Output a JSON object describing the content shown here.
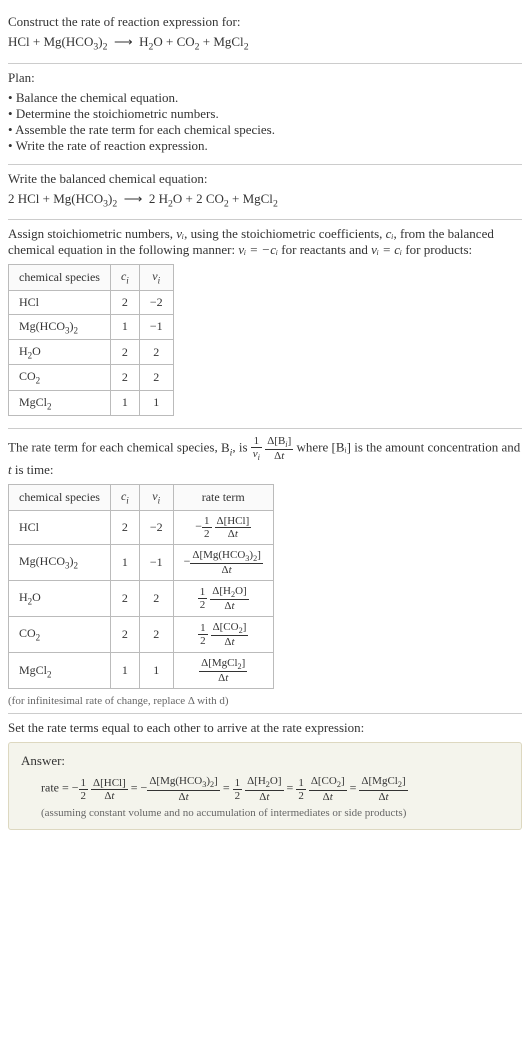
{
  "header": {
    "prompt": "Construct the rate of reaction expression for:",
    "equation_lhs": "HCl + Mg(HCO3)",
    "equation_arrow": "⟶",
    "equation_rhs": "H₂O + CO₂ + MgCl₂"
  },
  "plan": {
    "label": "Plan:",
    "items": [
      "Balance the chemical equation.",
      "Determine the stoichiometric numbers.",
      "Assemble the rate term for each chemical species.",
      "Write the rate of reaction expression."
    ]
  },
  "balanced": {
    "label": "Write the balanced chemical equation:",
    "equation": "2 HCl + Mg(HCO₃)₂  ⟶  2 H₂O + 2 CO₂ + MgCl₂"
  },
  "stoich": {
    "intro_a": "Assign stoichiometric numbers, ",
    "nu_i": "νᵢ",
    "intro_b": ", using the stoichiometric coefficients, ",
    "c_i": "cᵢ",
    "intro_c": ", from the balanced chemical equation in the following manner: ",
    "rel1": "νᵢ = −cᵢ",
    "intro_d": " for reactants and ",
    "rel2": "νᵢ = cᵢ",
    "intro_e": " for products:",
    "headers": [
      "chemical species",
      "cᵢ",
      "νᵢ"
    ],
    "rows": [
      {
        "species": "HCl",
        "c": "2",
        "nu": "−2"
      },
      {
        "species": "Mg(HCO₃)₂",
        "c": "1",
        "nu": "−1"
      },
      {
        "species": "H₂O",
        "c": "2",
        "nu": "2"
      },
      {
        "species": "CO₂",
        "c": "2",
        "nu": "2"
      },
      {
        "species": "MgCl₂",
        "c": "1",
        "nu": "1"
      }
    ]
  },
  "rate_intro": {
    "a": "The rate term for each chemical species, ",
    "b": "Bᵢ",
    "c": ", is ",
    "d": " where [Bᵢ] is the amount concentration and ",
    "e": "t",
    "f": " is time:"
  },
  "rate_table": {
    "headers": [
      "chemical species",
      "cᵢ",
      "νᵢ",
      "rate term"
    ],
    "rows": [
      {
        "species": "HCl",
        "c": "2",
        "nu": "−2",
        "sign": "−",
        "coef_num": "1",
        "coef_den": "2",
        "dnum": "Δ[HCl]",
        "dden": "Δt"
      },
      {
        "species": "Mg(HCO₃)₂",
        "c": "1",
        "nu": "−1",
        "sign": "−",
        "coef_num": "",
        "coef_den": "",
        "dnum": "Δ[Mg(HCO3)2]",
        "dden": "Δt"
      },
      {
        "species": "H₂O",
        "c": "2",
        "nu": "2",
        "sign": "",
        "coef_num": "1",
        "coef_den": "2",
        "dnum": "Δ[H2O]",
        "dden": "Δt"
      },
      {
        "species": "CO₂",
        "c": "2",
        "nu": "2",
        "sign": "",
        "coef_num": "1",
        "coef_den": "2",
        "dnum": "Δ[CO2]",
        "dden": "Δt"
      },
      {
        "species": "MgCl₂",
        "c": "1",
        "nu": "1",
        "sign": "",
        "coef_num": "",
        "coef_den": "",
        "dnum": "Δ[MgCl2]",
        "dden": "Δt"
      }
    ],
    "note": "(for infinitesimal rate of change, replace Δ with d)"
  },
  "final": {
    "intro": "Set the rate terms equal to each other to arrive at the rate expression:",
    "answer_label": "Answer:",
    "assume": "(assuming constant volume and no accumulation of intermediates or side products)"
  },
  "chart_data": {
    "type": "table",
    "title": "Stoichiometric numbers and rate terms",
    "tables": [
      {
        "columns": [
          "chemical species",
          "c_i",
          "ν_i"
        ],
        "rows": [
          [
            "HCl",
            2,
            -2
          ],
          [
            "Mg(HCO3)2",
            1,
            -1
          ],
          [
            "H2O",
            2,
            2
          ],
          [
            "CO2",
            2,
            2
          ],
          [
            "MgCl2",
            1,
            1
          ]
        ]
      },
      {
        "columns": [
          "chemical species",
          "c_i",
          "ν_i",
          "rate term"
        ],
        "rows": [
          [
            "HCl",
            2,
            -2,
            "-(1/2) Δ[HCl]/Δt"
          ],
          [
            "Mg(HCO3)2",
            1,
            -1,
            "- Δ[Mg(HCO3)2]/Δt"
          ],
          [
            "H2O",
            2,
            2,
            "(1/2) Δ[H2O]/Δt"
          ],
          [
            "CO2",
            2,
            2,
            "(1/2) Δ[CO2]/Δt"
          ],
          [
            "MgCl2",
            1,
            1,
            "Δ[MgCl2]/Δt"
          ]
        ]
      }
    ],
    "rate_expression": "rate = -(1/2) Δ[HCl]/Δt = - Δ[Mg(HCO3)2]/Δt = (1/2) Δ[H2O]/Δt = (1/2) Δ[CO2]/Δt = Δ[MgCl2]/Δt"
  }
}
